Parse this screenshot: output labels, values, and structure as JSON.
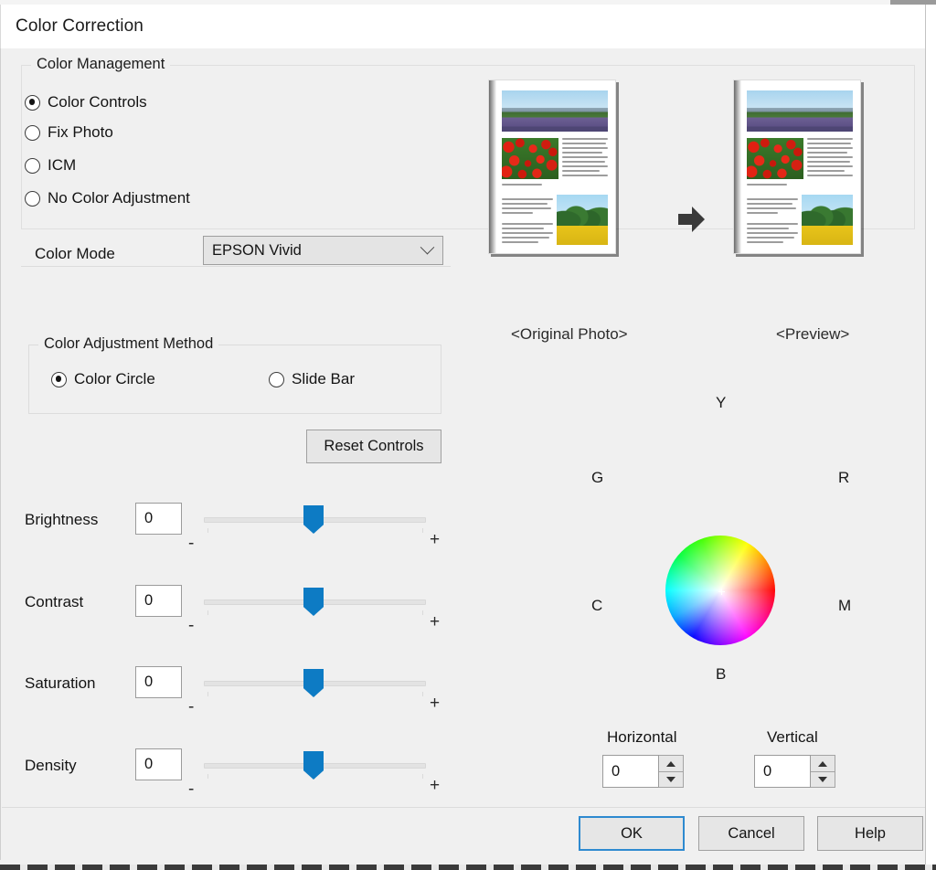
{
  "window": {
    "title": "Color Correction"
  },
  "color_management": {
    "group_title": "Color Management",
    "options": [
      {
        "label": "Color Controls",
        "selected": true
      },
      {
        "label": "Fix Photo",
        "selected": false
      },
      {
        "label": "ICM",
        "selected": false
      },
      {
        "label": "No Color Adjustment",
        "selected": false
      }
    ],
    "color_mode": {
      "label": "Color Mode",
      "value": "EPSON Vivid"
    }
  },
  "adjustment_method": {
    "group_title": "Color Adjustment Method",
    "options": [
      {
        "label": "Color Circle",
        "selected": true
      },
      {
        "label": "Slide Bar",
        "selected": false
      }
    ]
  },
  "reset_button": {
    "label": "Reset Controls"
  },
  "sliders": [
    {
      "label": "Brightness",
      "value": "0",
      "minus": "-",
      "plus": "+"
    },
    {
      "label": "Contrast",
      "value": "0",
      "minus": "-",
      "plus": "+"
    },
    {
      "label": "Saturation",
      "value": "0",
      "minus": "-",
      "plus": "+"
    },
    {
      "label": "Density",
      "value": "0",
      "minus": "-",
      "plus": "+"
    }
  ],
  "preview": {
    "original_caption": "<Original Photo>",
    "preview_caption": "<Preview>"
  },
  "color_circle": {
    "labels": {
      "top": "Y",
      "left": "G",
      "right": "R",
      "bottom_left": "C",
      "bottom_right": "M",
      "bottom": "B"
    },
    "horizontal": {
      "label": "Horizontal",
      "value": "0"
    },
    "vertical": {
      "label": "Vertical",
      "value": "0"
    }
  },
  "footer": {
    "ok": "OK",
    "cancel": "Cancel",
    "help": "Help"
  },
  "colors": {
    "accent_blue": "#0d7bc4",
    "focus_border": "#2e8ad0",
    "dialog_bg": "#f0f0f0",
    "text": "#141414"
  }
}
